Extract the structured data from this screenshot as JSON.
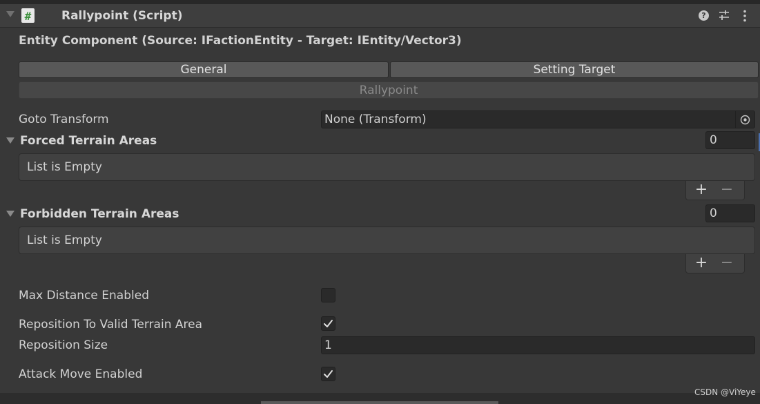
{
  "component": {
    "title": "Rallypoint (Script)",
    "script_icon": "#",
    "help_icon_glyph": "?",
    "icons": [
      "collapse-arrow-icon",
      "script-icon",
      "help-icon",
      "presets-icon",
      "context-menu-icon"
    ]
  },
  "entity_heading": "Entity Component (Source: IFactionEntity - Target: IEntity/Vector3)",
  "tabs": [
    {
      "label": "General",
      "state": "normal"
    },
    {
      "label": "Setting Target",
      "state": "normal"
    },
    {
      "label": "Rallypoint",
      "state": "selected"
    }
  ],
  "goto_transform": {
    "label": "Goto Transform",
    "value": "None (Transform)",
    "picker_icon": "object-picker-icon"
  },
  "forced_terrain_areas": {
    "label": "Forced Terrain Areas",
    "size": "0",
    "empty_text": "List is Empty",
    "add_glyph": "+",
    "remove_glyph": "−"
  },
  "forbidden_terrain_areas": {
    "label": "Forbidden Terrain Areas",
    "size": "0",
    "empty_text": "List is Empty",
    "add_glyph": "+",
    "remove_glyph": "−"
  },
  "max_distance_enabled": {
    "label": "Max Distance Enabled",
    "checked": false
  },
  "reposition_to_valid_terrain_area": {
    "label": "Reposition To Valid Terrain Area",
    "checked": true
  },
  "reposition_size": {
    "label": "Reposition Size",
    "value": "1"
  },
  "attack_move_enabled": {
    "label": "Attack Move Enabled",
    "checked": true
  },
  "watermark": "CSDN @ViYeye",
  "colors": {
    "background": "#383838",
    "header": "#3e3e3e",
    "field": "#2a2a2a",
    "tab": "#585858",
    "text": "#d2d2d2",
    "script_icon_green": "#3a8f3a"
  }
}
